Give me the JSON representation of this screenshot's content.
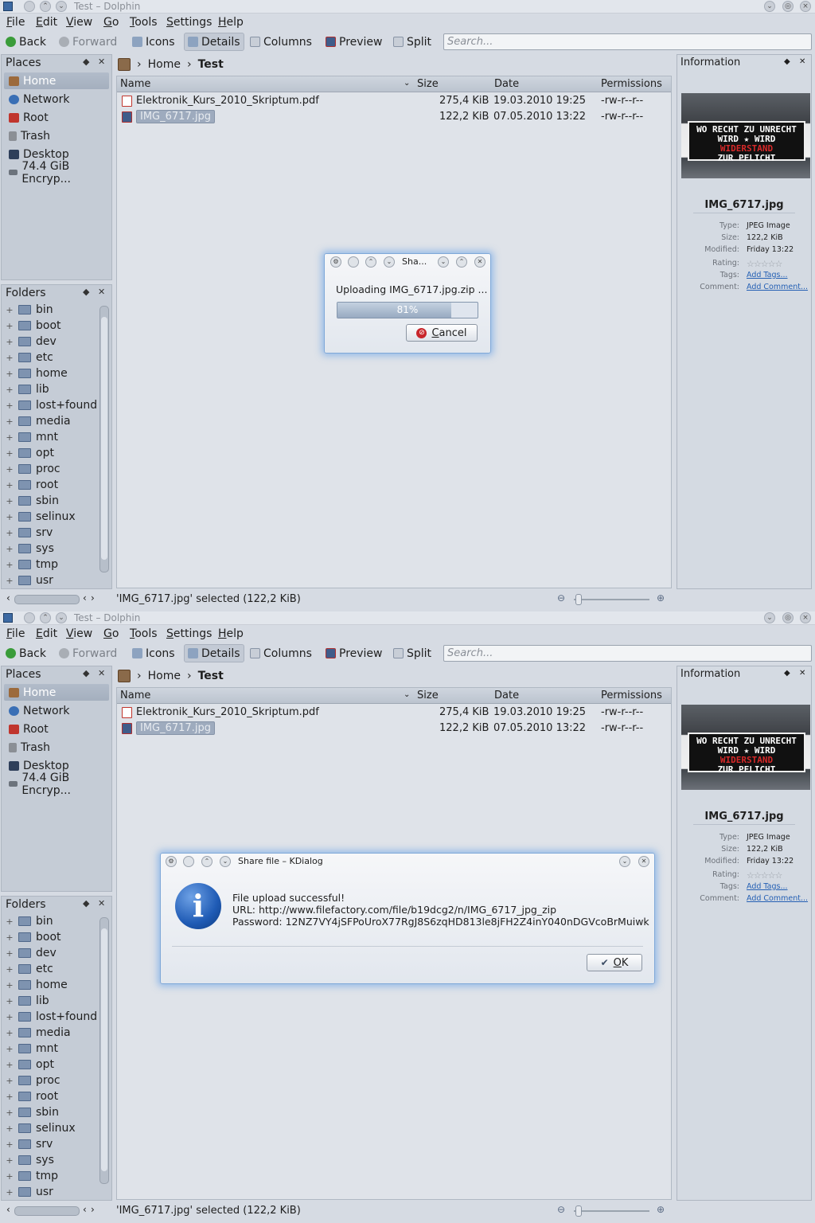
{
  "window": {
    "title": "Test – Dolphin"
  },
  "menu": [
    "File",
    "Edit",
    "View",
    "Go",
    "Tools",
    "Settings",
    "Help"
  ],
  "toolbar": {
    "back": "Back",
    "forward": "Forward",
    "icons": "Icons",
    "details": "Details",
    "columns": "Columns",
    "preview": "Preview",
    "split": "Split",
    "search_placeholder": "Search..."
  },
  "places": {
    "title": "Places",
    "items": [
      "Home",
      "Network",
      "Root",
      "Trash",
      "Desktop",
      "74.4 GiB Encryp..."
    ]
  },
  "folders": {
    "title": "Folders",
    "items": [
      "bin",
      "boot",
      "dev",
      "etc",
      "home",
      "lib",
      "lost+found",
      "media",
      "mnt",
      "opt",
      "proc",
      "root",
      "sbin",
      "selinux",
      "srv",
      "sys",
      "tmp",
      "usr"
    ]
  },
  "breadcrumb": {
    "home": "Home",
    "current": "Test"
  },
  "columns": {
    "name": "Name",
    "size": "Size",
    "date": "Date",
    "permissions": "Permissions"
  },
  "files": [
    {
      "name": "Elektronik_Kurs_2010_Skriptum.pdf",
      "size": "275,4 KiB",
      "date": "19.03.2010 19:25",
      "perm": "-rw-r--r--"
    },
    {
      "name": "IMG_6717.jpg",
      "size": "122,2 KiB",
      "date": "07.05.2010 13:22",
      "perm": "-rw-r--r--"
    }
  ],
  "status": "'IMG_6717.jpg' selected (122,2 KiB)",
  "info": {
    "title": "Information",
    "filename": "IMG_6717.jpg",
    "thumb_line1": "WO RECHT ZU UNRECHT",
    "thumb_line2": "WIRD ★ WIRD",
    "thumb_line3": "WIDERSTAND",
    "thumb_line4": "ZUR PFLICHT",
    "type_k": "Type:",
    "type_v": "JPEG Image",
    "size_k": "Size:",
    "size_v": "122,2 KiB",
    "mod_k": "Modified:",
    "mod_v": "Friday 13:22",
    "rating_k": "Rating:",
    "rating_v": "☆☆☆☆☆",
    "tags_k": "Tags:",
    "tags_v": "Add Tags...",
    "comment_k": "Comment:",
    "comment_v": "Add Comment..."
  },
  "upload_dialog": {
    "title": "Sha...",
    "message": "Uploading IMG_6717.jpg.zip ...",
    "progress": 81,
    "progress_label": "81%",
    "cancel": "Cancel"
  },
  "result_dialog": {
    "title": "Share file – KDialog",
    "line1": "File upload successful!",
    "line2": "URL: http://www.filefactory.com/file/b19dcg2/n/IMG_6717_jpg_zip",
    "line3": "Password: 12NZ7VY4jSFPoUroX77RgJ8S6zqHD813le8jFH2Z4inY040nDGVcoBrMuiwk",
    "ok": "OK"
  },
  "colors": {
    "accent": "#7fa8d8",
    "selection": "#9eabbe"
  }
}
